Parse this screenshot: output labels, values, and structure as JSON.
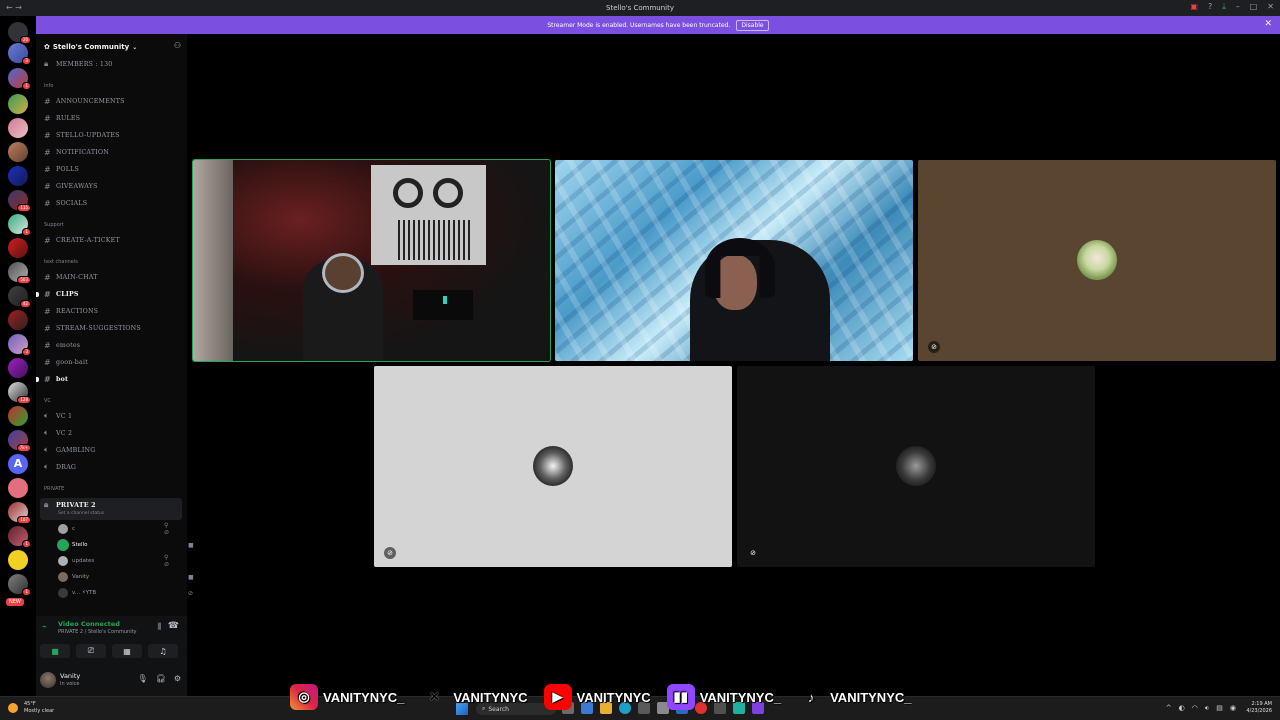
{
  "window": {
    "title": "Stello's Community",
    "back_icon": "arrow-left-icon"
  },
  "banner": {
    "text": "Streamer Mode is enabled. Usernames have been truncated.",
    "button": "Disable"
  },
  "server_rail": {
    "home_badge": "20",
    "badges": [
      "3",
      "1",
      "",
      "",
      "",
      "",
      "115",
      "1",
      "503",
      "42",
      "3",
      "",
      "128",
      "7k+",
      "",
      "",
      "107",
      "1",
      "",
      "1"
    ],
    "new_label": "NEW"
  },
  "guild": {
    "name": "Stello's Community",
    "members_label": "MEMBERS : 130"
  },
  "channels": {
    "cat_info": "info",
    "announcements": "ANNOUNCEMENTS",
    "rules": "RULES",
    "stello_updates": "STELLO-UPDATES",
    "notification": "NOTIFICATION",
    "polls": "POLLS",
    "giveaways": "GIVEAWAYS",
    "socials": "SOCIALS",
    "cat_support": "Support",
    "create_ticket": "CREATE-A-TICKET",
    "cat_text": "text channels",
    "main_chat": "MAIN-CHAT",
    "clips": "CLIPS",
    "reactions": "REACTIONS",
    "stream_suggestions": "STREAM-SUGGESTIONS",
    "emotes": "emotes",
    "goon_bait": "goon-bait",
    "bot": "bot",
    "cat_vc": "VC",
    "vc1": "VC 1",
    "vc2": "VC 2",
    "gambling": "GAMBLING",
    "drag": "DRAG",
    "cat_private": "PRIVATE",
    "private2": "PRIVATE 2",
    "private2_status": "Set a channel status"
  },
  "voice_users": [
    {
      "name": "c"
    },
    {
      "name": "Stello"
    },
    {
      "name": "updates"
    },
    {
      "name": "Vanity"
    },
    {
      "name": "v... ⚡YTB"
    }
  ],
  "voice_panel": {
    "title": "Video Connected",
    "subtitle": "PRIVATE 2 / Stello's Community"
  },
  "user_panel": {
    "name": "Vanity",
    "status": "In voice"
  },
  "taskbar": {
    "temp": "45°F",
    "weather": "Mostly clear",
    "search": "Search",
    "time": "2:19 AM",
    "date": "4/23/2026"
  },
  "overlay": {
    "instagram": "VANITYNYC_",
    "youtube": "VANITYNYC",
    "x": "VANITYNYC",
    "twitch": "VANITYNYC_",
    "tiktok": "VANITYNYC_"
  },
  "colors": {
    "banner": "#7b4fe0",
    "speaking_ring": "#23a55a",
    "tile_brown": "#5a4530",
    "tile_gray": "#d4d4d4",
    "tile_dark": "#121212"
  }
}
